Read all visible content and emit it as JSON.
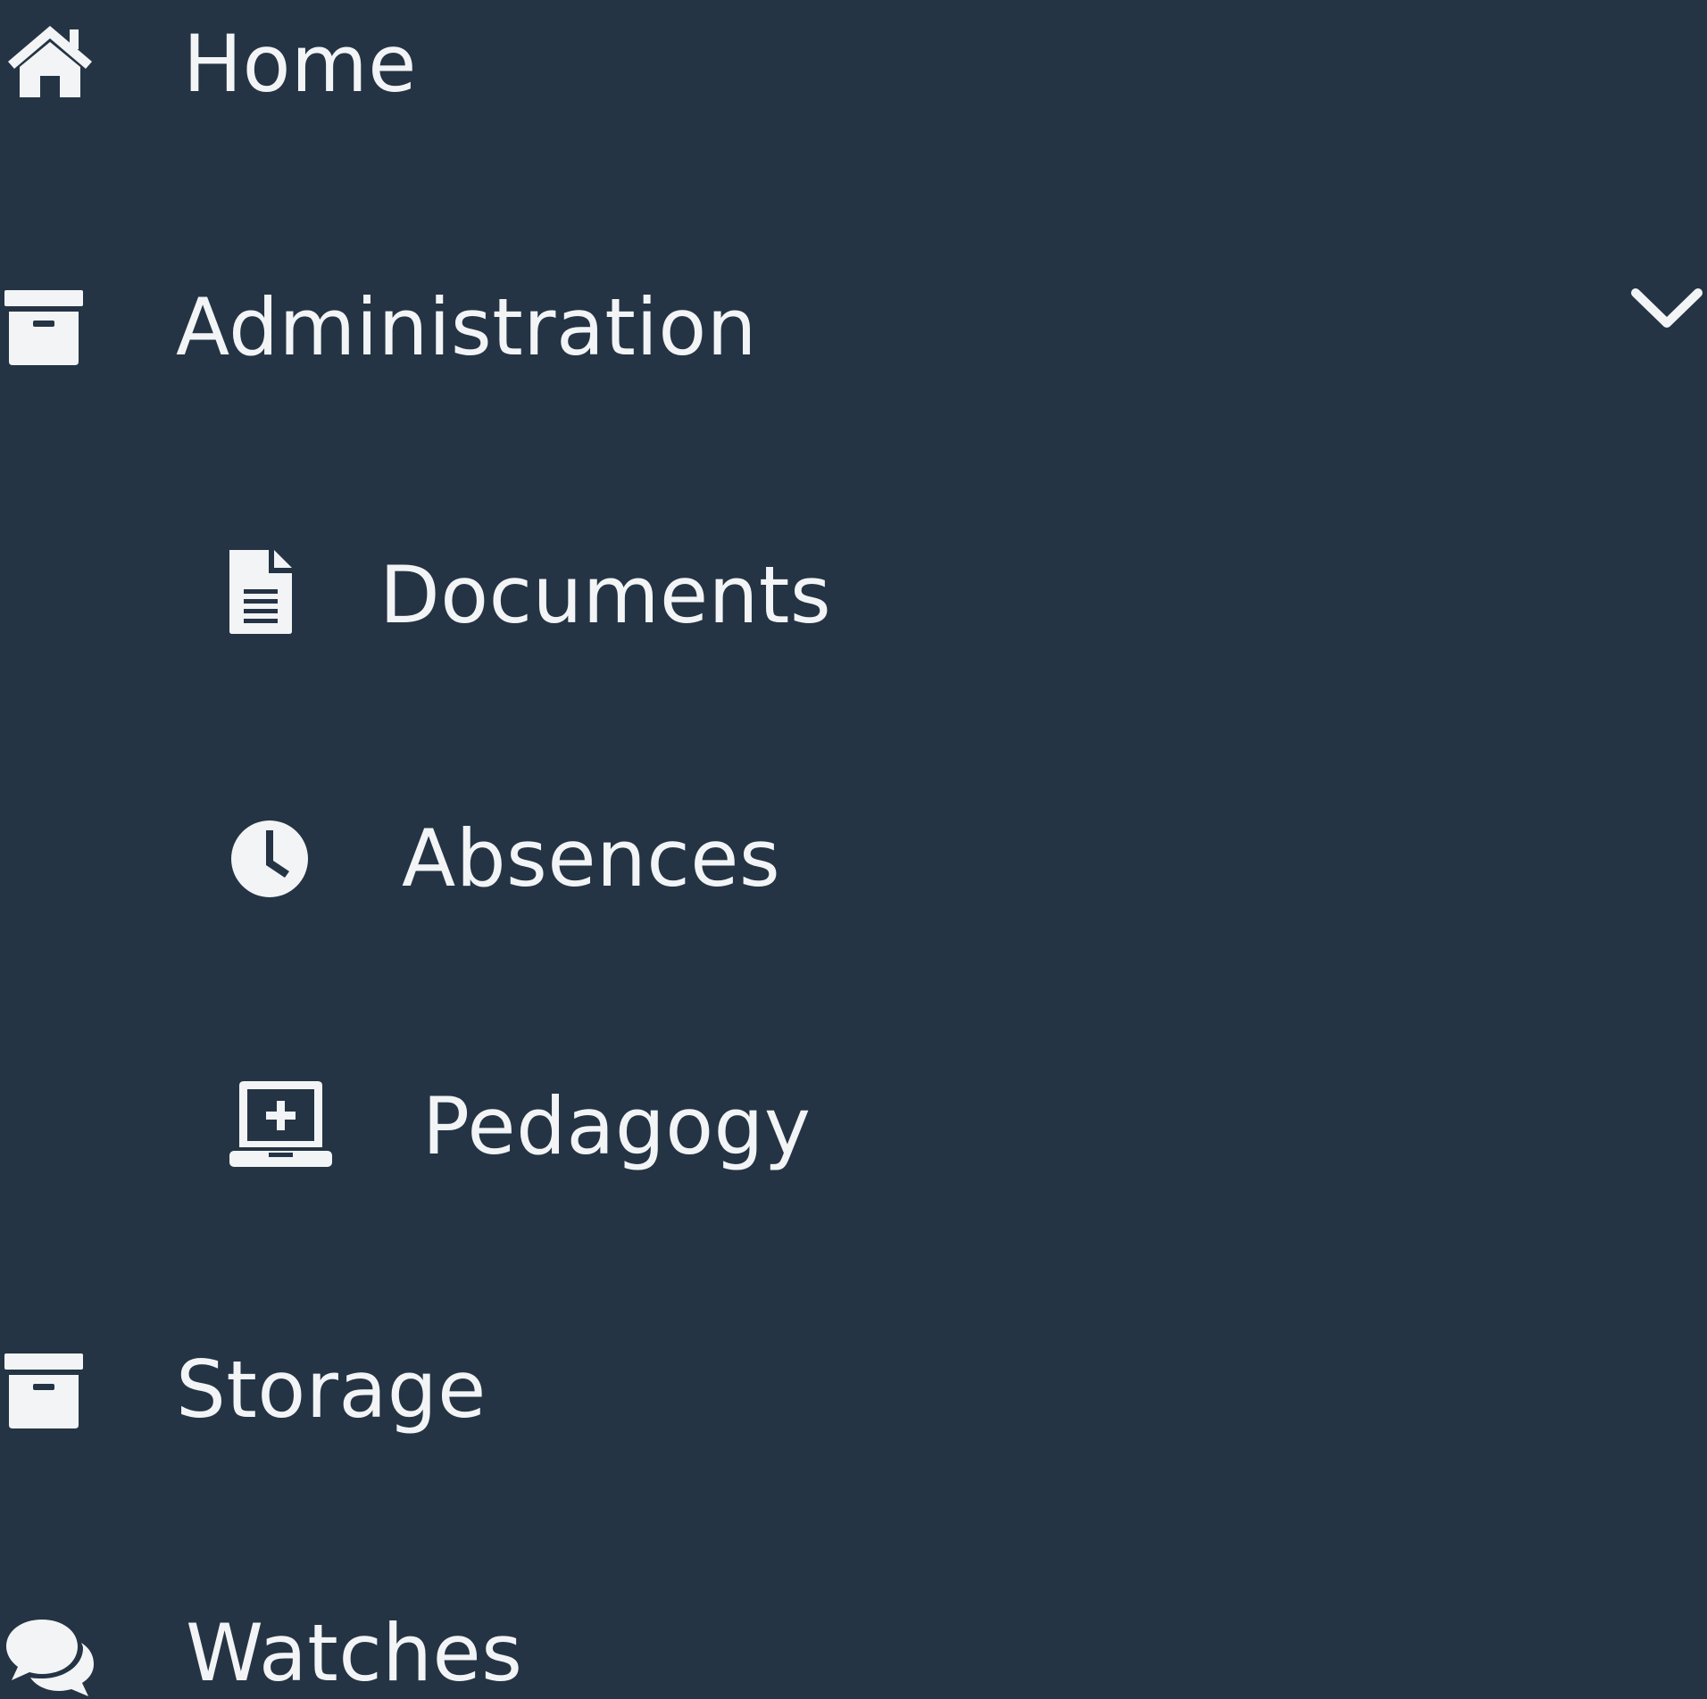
{
  "theme": {
    "background": "#243444",
    "text": "#f2f4f6"
  },
  "menu": {
    "items": [
      {
        "id": "home",
        "label": "Home",
        "icon": "home-icon"
      },
      {
        "id": "administration",
        "label": "Administration",
        "icon": "archive-box-icon",
        "expanded": true,
        "toggle_icon": "chevron-down-icon",
        "children": [
          {
            "id": "documents",
            "label": "Documents",
            "icon": "document-icon"
          },
          {
            "id": "absences",
            "label": "Absences",
            "icon": "clock-icon"
          },
          {
            "id": "pedagogy",
            "label": "Pedagogy",
            "icon": "laptop-plus-icon"
          }
        ]
      },
      {
        "id": "storage",
        "label": "Storage",
        "icon": "archive-box-icon"
      },
      {
        "id": "watches",
        "label": "Watches",
        "icon": "chat-bubbles-icon"
      }
    ]
  }
}
